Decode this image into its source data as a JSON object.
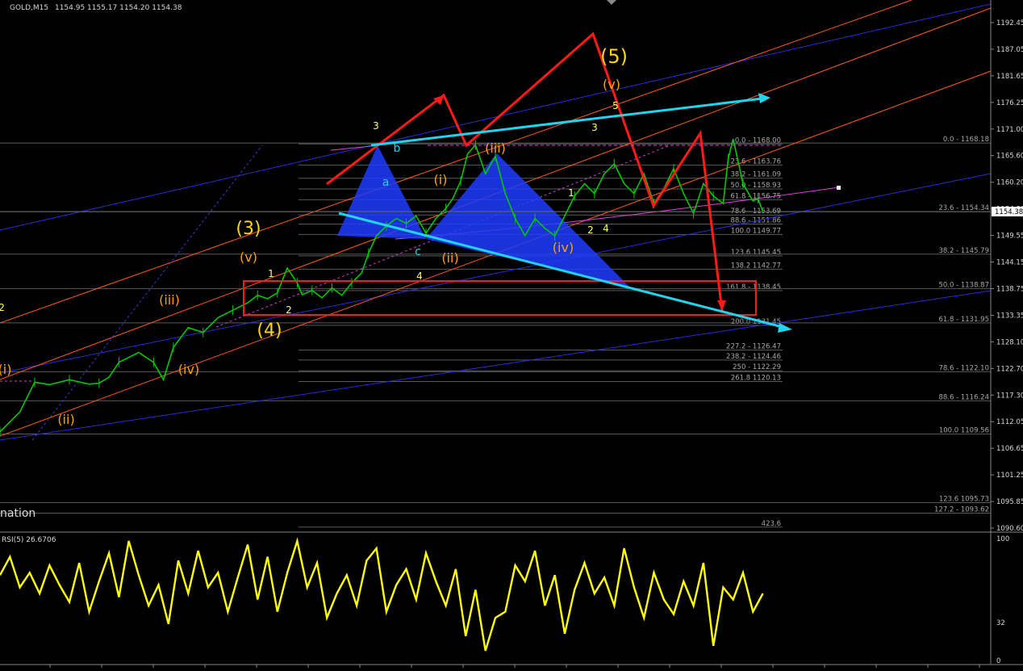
{
  "window": {
    "symbol": "GOLD,M15",
    "ohlc": "1154.95 1155.17 1154.20 1154.38",
    "rsi_label": "RSI(5) 26.6706",
    "left_cut_label": "nation"
  },
  "colors": {
    "background": "#000000",
    "price": "#00c800",
    "rsi": "#ffff00",
    "wave_label": "#ffa000",
    "wave_label_major": "#ffd700",
    "minor_label": "#ffff66",
    "projection": "#ff1a1a",
    "cyan_line": "#22d3ee",
    "channel_blue": "#2b2bd8",
    "channel_orange": "#ff5a1e",
    "pattern_fill": "#1f3cff",
    "fib_line": "#5a5a5a",
    "fib_text": "#a8a8a8",
    "axis_text": "#d8d8d8"
  },
  "chart_data": [
    {
      "type": "line",
      "title": "GOLD,M15",
      "subtitle": "1154.95 1155.17 1154.20 1154.38",
      "ylim": [
        1090.6,
        1195.0
      ],
      "y_ticks": [
        "1192.45",
        "1187.05",
        "1181.65",
        "1176.25",
        "1171.00",
        "1165.60",
        "1160.20",
        "1154.80",
        "1149.55",
        "1144.15",
        "1138.75",
        "1133.35",
        "1128.10",
        "1122.70",
        "1117.30",
        "1112.05",
        "1106.65",
        "1101.25",
        "1095.85",
        "1090.60"
      ],
      "current_price": "1154.38",
      "series": [
        {
          "x": [
            0,
            0.02,
            0.035,
            0.05,
            0.07,
            0.09,
            0.1,
            0.11,
            0.12,
            0.14,
            0.155,
            0.165,
            0.175,
            0.19,
            0.205,
            0.22,
            0.235,
            0.25,
            0.26,
            0.27,
            0.28,
            0.29,
            0.3,
            0.305,
            0.315,
            0.325,
            0.335,
            0.345,
            0.355,
            0.365,
            0.372,
            0.38,
            0.39,
            0.4,
            0.41,
            0.42,
            0.43,
            0.44,
            0.45,
            0.457,
            0.465,
            0.472,
            0.48,
            0.49,
            0.5,
            0.51,
            0.52,
            0.53,
            0.54,
            0.55,
            0.56,
            0.57,
            0.58,
            0.59,
            0.6,
            0.61,
            0.62,
            0.63,
            0.64,
            0.65,
            0.66,
            0.67,
            0.68,
            0.69,
            0.7,
            0.71,
            0.72,
            0.73,
            0.735,
            0.74,
            0.75,
            0.76,
            0.765,
            0.77
          ],
          "values": [
            1110,
            1114,
            1120,
            1119.5,
            1120.5,
            1119.6,
            1119.8,
            1121,
            1124,
            1126,
            1124,
            1120.5,
            1127,
            1131,
            1130,
            1133,
            1134.5,
            1136,
            1137.5,
            1136.8,
            1138,
            1143,
            1140,
            1137.6,
            1138.5,
            1137,
            1139,
            1137.5,
            1140,
            1142,
            1146,
            1149.5,
            1151.5,
            1153,
            1152,
            1153.5,
            1150,
            1153,
            1155,
            1157,
            1160.5,
            1166,
            1167.8,
            1162,
            1165.5,
            1158,
            1153,
            1149.5,
            1153,
            1151,
            1149.5,
            1153.5,
            1157.5,
            1160,
            1158,
            1162,
            1164,
            1160,
            1158,
            1162,
            1156,
            1159,
            1163,
            1158,
            1154,
            1160,
            1157.5,
            1156,
            1165,
            1169,
            1160,
            1156.5,
            1157,
            1154.38
          ]
        }
      ],
      "wave_labels": [
        "(i)",
        "(ii)",
        "(iii)",
        "(iv)",
        "(v)",
        "(3)",
        "(4)",
        "(5)",
        "(i)",
        "(ii)",
        "(iii)",
        "(iv)",
        "(v)",
        "a",
        "b",
        "c",
        "1",
        "2",
        "3",
        "4",
        "5",
        "1",
        "2",
        "3",
        "4",
        "2"
      ],
      "fib_levels_a": [
        "0.0 - 1168.00",
        "23.6 - 1163.76",
        "38.2 - 1161.09",
        "50.0 - 1158.93",
        "61.8 - 1156.75",
        "78.6 - 1153.69",
        "88.6 - 1151.86",
        "100.0 1149.77",
        "123.6 1145.45",
        "138.2 1142.77",
        "161.8 - 1138.45",
        "200.0 1131.45",
        "227.2 - 1126.47",
        "238.2 - 1124.46",
        "250 - 1122.29",
        "261.8 1120.13",
        "423.6"
      ],
      "fib_levels_b": [
        "0.0 - 1168.18",
        "23.6 - 1154.34",
        "38.2 - 1145.79",
        "50.0 - 1138.87",
        "61.8 - 1131.95",
        "78.6 - 1122.10",
        "88.6 - 1116.24",
        "100.0 1109.56",
        "123.6 1095.73",
        "127.2 - 1093.62"
      ]
    },
    {
      "type": "line",
      "title": "RSI(5) 26.6706",
      "ylim": [
        0,
        100
      ],
      "y_ticks": [
        "100",
        "32",
        "0"
      ],
      "series": [
        {
          "x": [
            0,
            0.01,
            0.02,
            0.03,
            0.04,
            0.05,
            0.06,
            0.07,
            0.08,
            0.09,
            0.1,
            0.11,
            0.12,
            0.13,
            0.14,
            0.15,
            0.16,
            0.17,
            0.18,
            0.19,
            0.2,
            0.21,
            0.22,
            0.23,
            0.24,
            0.25,
            0.26,
            0.27,
            0.28,
            0.29,
            0.3,
            0.31,
            0.32,
            0.33,
            0.34,
            0.35,
            0.36,
            0.37,
            0.38,
            0.39,
            0.4,
            0.41,
            0.42,
            0.43,
            0.44,
            0.45,
            0.46,
            0.47,
            0.48,
            0.49,
            0.5,
            0.51,
            0.52,
            0.53,
            0.54,
            0.55,
            0.56,
            0.57,
            0.58,
            0.59,
            0.6,
            0.61,
            0.62,
            0.63,
            0.64,
            0.65,
            0.66,
            0.67,
            0.68,
            0.69,
            0.7,
            0.71,
            0.72,
            0.73,
            0.74,
            0.75,
            0.76,
            0.77
          ],
          "values": [
            70,
            85,
            60,
            72,
            55,
            78,
            62,
            48,
            80,
            40,
            65,
            88,
            52,
            98,
            70,
            45,
            62,
            30,
            82,
            55,
            90,
            60,
            72,
            40,
            68,
            95,
            50,
            85,
            40,
            72,
            98,
            60,
            80,
            35,
            55,
            70,
            45,
            82,
            92,
            40,
            62,
            75,
            50,
            88,
            65,
            45,
            75,
            20,
            58,
            8,
            35,
            40,
            78,
            65,
            90,
            45,
            70,
            22,
            58,
            80,
            55,
            68,
            45,
            92,
            60,
            35,
            72,
            50,
            38,
            65,
            45,
            80,
            12,
            60,
            50,
            72,
            40,
            55
          ]
        }
      ]
    }
  ]
}
